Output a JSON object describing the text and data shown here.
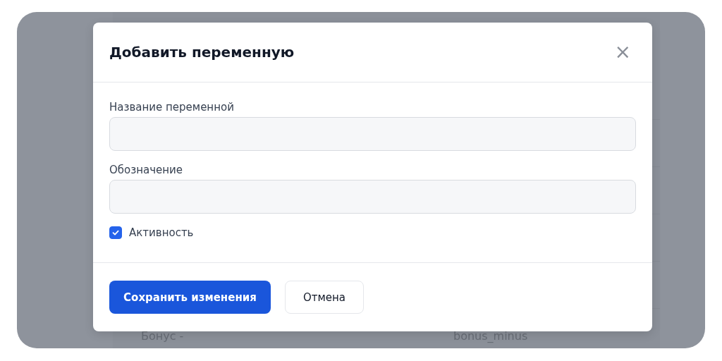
{
  "background_table": {
    "rows": [
      {
        "name": "Бонус -",
        "code": "bonus_minus"
      }
    ]
  },
  "dialog": {
    "title": "Добавить переменную",
    "close": "×",
    "fields": [
      {
        "label": "Название переменной"
      },
      {
        "label": "Обозначение"
      }
    ],
    "checkbox": {
      "label": "Активность",
      "checked": true
    },
    "buttons": [
      {
        "label": "Сохранить изменения",
        "kind": "primary"
      },
      {
        "label": "Отмена",
        "kind": "secondary"
      }
    ]
  }
}
